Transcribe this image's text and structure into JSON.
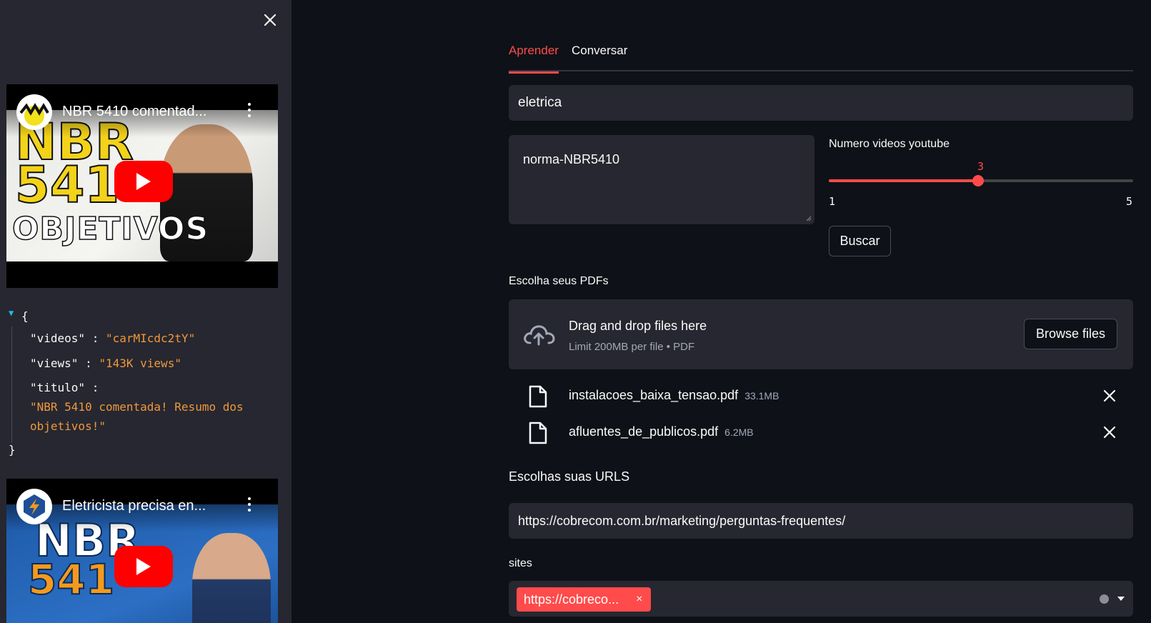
{
  "colors": {
    "accent": "#ff4b4b",
    "background": "#0e1117",
    "sidebar": "#262730",
    "json_string": "#f0973c"
  },
  "sidebar": {
    "videos": [
      {
        "title": "NBR 5410 comentad...",
        "thumb_line1": "NBR",
        "thumb_line2": "541",
        "thumb_line3": "OBJETIVOS"
      },
      {
        "title": "Eletricista precisa en...",
        "thumb_line1": "NBR",
        "thumb_line2": "541"
      }
    ],
    "json": {
      "open": "{",
      "close": "}",
      "videos_key": "\"videos\"",
      "videos_value": "\"carMIcdc2tY\"",
      "views_key": "\"views\"",
      "views_value": "\"143K views\"",
      "titulo_key": "\"titulo\"",
      "titulo_value_line1": "\"NBR 5410 comentada! Resumo dos",
      "titulo_value_line2": "objetivos!\"",
      "colon": ":"
    }
  },
  "main": {
    "tabs": [
      {
        "label": "Aprender",
        "active": true
      },
      {
        "label": "Conversar",
        "active": false
      }
    ],
    "topic_input": "eletrica",
    "query_textarea": "norma-NBR5410",
    "slider": {
      "label": "Numero videos youtube",
      "value": 3,
      "min": 1,
      "max": 5
    },
    "buscar_label": "Buscar",
    "pdf_label": "Escolha seus PDFs",
    "uploader": {
      "title": "Drag and drop files here",
      "limit": "Limit 200MB per file • PDF",
      "browse_label": "Browse files"
    },
    "files": [
      {
        "name": "instalacoes_baixa_tensao.pdf",
        "size": "33.1MB"
      },
      {
        "name": "afluentes_de_publicos.pdf",
        "size": "6.2MB"
      }
    ],
    "urls_label": "Escolhas suas URLS",
    "url_input": "https://cobrecom.com.br/marketing/perguntas-frequentes/",
    "sites_label": "sites",
    "sites_chip": "https://cobreco...",
    "chip_remove": "×"
  }
}
